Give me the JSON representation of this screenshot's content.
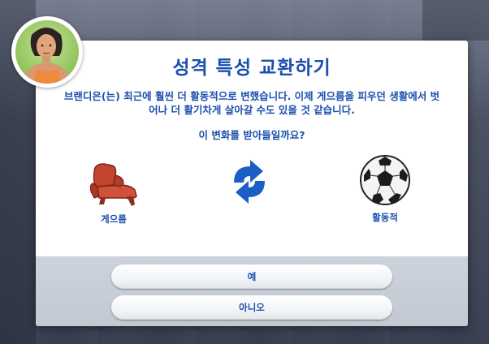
{
  "dialog": {
    "title": "성격 특성 교환하기",
    "description": "브랜디은(는) 최근에 훨씬 더 활동적으로 변했습니다. 이제 게으름을 피우던 생활에서 벗어나 더 활기차게 살아갈 수도 있을 것 같습니다.",
    "question": "이 변화를 받아들일까요?",
    "old_trait": {
      "label": "게으름",
      "icon": "recliner-icon"
    },
    "swap_icon": "swap-arrows-icon",
    "new_trait": {
      "label": "활동적",
      "icon": "soccer-ball-icon"
    },
    "yes_label": "예",
    "no_label": "아니오"
  },
  "colors": {
    "text": "#1a4fae",
    "swap_arrows": "#1a5fc4",
    "recliner": "#b8402c",
    "avatar_bg": "#8fc25a"
  }
}
